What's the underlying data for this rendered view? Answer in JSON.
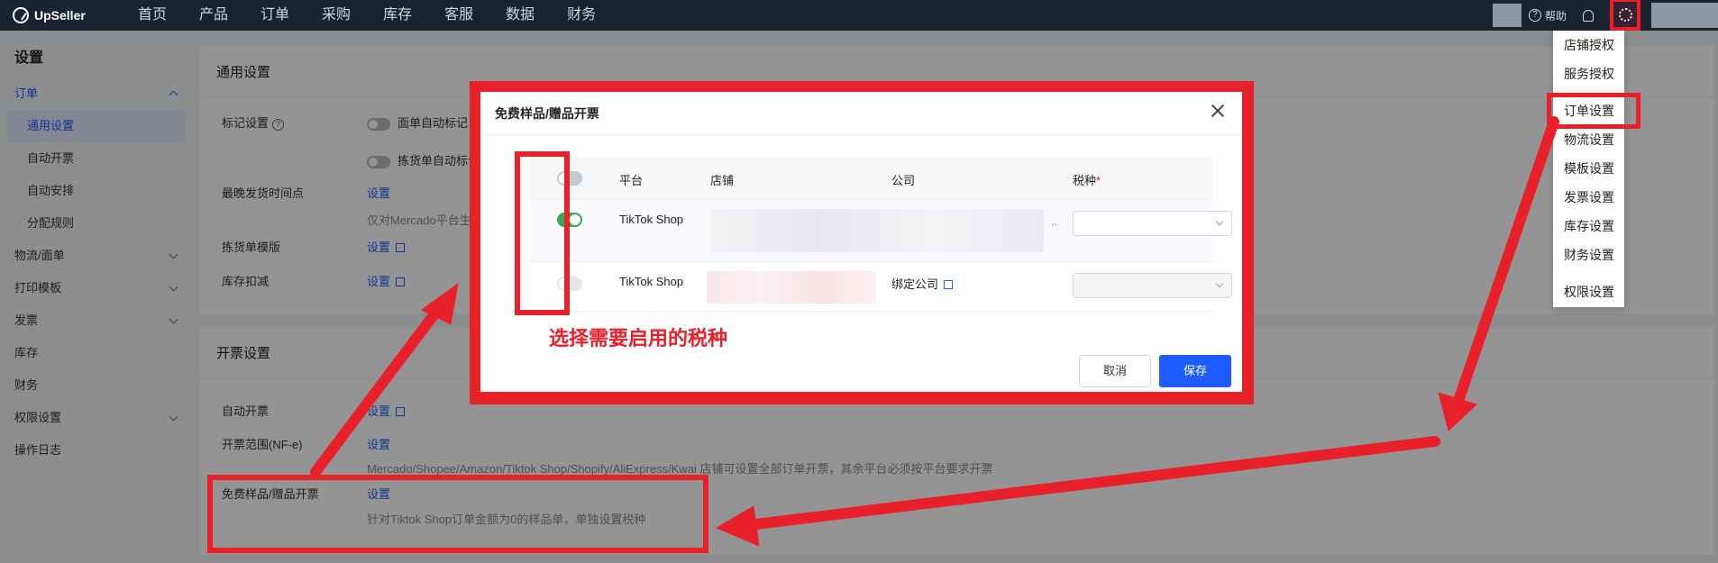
{
  "app": {
    "brand": "UpSeller"
  },
  "nav": {
    "items": [
      "首页",
      "产品",
      "订单",
      "采购",
      "库存",
      "客服",
      "数据",
      "财务"
    ]
  },
  "topbar": {
    "help": "帮助"
  },
  "sidebar": {
    "title": "设置",
    "groups": [
      {
        "label": "订单",
        "expanded": true,
        "children": [
          "通用设置",
          "自动开票",
          "自动安排",
          "分配规则"
        ],
        "active_child": "通用设置"
      },
      {
        "label": "物流/面单"
      },
      {
        "label": "打印模板"
      },
      {
        "label": "发票"
      },
      {
        "label": "库存"
      },
      {
        "label": "财务"
      },
      {
        "label": "权限设置"
      },
      {
        "label": "操作日志"
      }
    ]
  },
  "general": {
    "title": "通用设置",
    "mark_label": "标记设置",
    "toggle1": "面单自动标记",
    "toggle2": "拣货单自动标记",
    "ship_label": "最晚发货时间点",
    "ship_link": "设置",
    "ship_hint": "仅对Mercado平台生效",
    "pick_label": "拣货单模版",
    "pick_link": "设置",
    "stock_label": "库存扣减",
    "stock_link": "设置"
  },
  "invoice": {
    "title": "开票设置",
    "auto_label": "自动开票",
    "auto_link": "设置",
    "range_label": "开票范围(NF-e)",
    "range_link": "设置",
    "range_hint": "Mercado/Shopee/Amazon/Tiktok Shop/Shopify/AliExpress/Kwai 店铺可设置全部订单开票，其余平台必须按平台要求开票",
    "free_label": "免费样品/赠品开票",
    "free_link": "设置",
    "free_hint": "针对Tiktok Shop订单金额为0的样品单，单独设置税种"
  },
  "dropdown": {
    "items": [
      "店铺授权",
      "服务授权",
      "订单设置",
      "物流设置",
      "模板设置",
      "发票设置",
      "库存设置",
      "财务设置",
      "权限设置"
    ],
    "highlighted": "订单设置"
  },
  "modal": {
    "title": "免费样品/赠品开票",
    "columns": {
      "platform": "平台",
      "shop": "店铺",
      "company": "公司",
      "tax": "税种"
    },
    "rows": [
      {
        "platform": "TikTok Shop",
        "enabled": true,
        "company_suffix": "..",
        "tax": ""
      },
      {
        "platform": "TikTok Shop",
        "enabled": false,
        "company_link": "绑定公司",
        "tax": ""
      }
    ],
    "cancel": "取消",
    "save": "保存"
  },
  "annotation": {
    "text": "选择需要启用的税种"
  },
  "colors": {
    "accent": "#1e5cff",
    "highlight": "#e8202a",
    "toggle_on": "#34a853",
    "topbar": "#1b2333"
  }
}
